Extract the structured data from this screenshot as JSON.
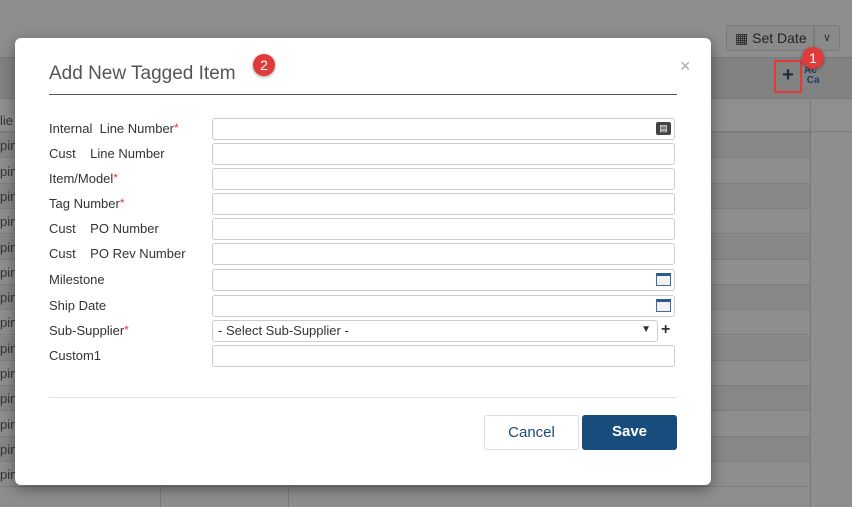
{
  "background": {
    "set_date_label": "Set Date",
    "rows": [
      "lie",
      "ping",
      "ping",
      "ping",
      "ping",
      "ping",
      "ping",
      "ping",
      "ping",
      "ping",
      "ping",
      "ping",
      "ping",
      "ping",
      "ping"
    ]
  },
  "badges": {
    "one": "1",
    "two": "2"
  },
  "modal": {
    "title": "Add New Tagged Item",
    "close": "×",
    "fields": [
      {
        "label": "Internal  Line Number",
        "required": true,
        "value": "",
        "icon": "contact-card-icon"
      },
      {
        "label": "Cust    Line Number",
        "required": false,
        "value": ""
      },
      {
        "label": "Item/Model",
        "required": true,
        "value": ""
      },
      {
        "label": "Tag Number",
        "required": true,
        "value": ""
      },
      {
        "label": "Cust    PO Number",
        "required": false,
        "value": ""
      },
      {
        "label": "Cust    PO Rev Number",
        "required": false,
        "value": ""
      },
      {
        "label": "Milestone",
        "required": false,
        "value": "",
        "icon": "calendar-icon"
      },
      {
        "label": "Ship Date",
        "required": false,
        "value": "",
        "icon": "calendar-icon"
      },
      {
        "label": "Sub-Supplier",
        "required": true,
        "value": "- Select Sub-Supplier -",
        "type": "select"
      },
      {
        "label": "Custom1",
        "required": false,
        "value": ""
      }
    ],
    "cancel_label": "Cancel",
    "save_label": "Save"
  },
  "colors": {
    "accent": "#174c7c",
    "required": "#e53935",
    "badge": "#e03a3a"
  }
}
